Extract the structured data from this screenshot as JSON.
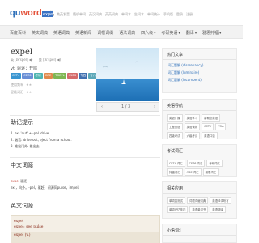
{
  "header": {
    "logo_qu": "qu",
    "logo_word": "word",
    "logo_cd": "词典",
    "search_value": "expel",
    "top_links": [
      "美英发音",
      "随机单词",
      "英汉词典",
      "英英词典",
      "单词本",
      "生词本",
      "单词统计",
      "手机版",
      "登录",
      "注册"
    ]
  },
  "nav": {
    "items": [
      "百度百科",
      "英文词典",
      "英语词典",
      "英语新闻",
      "词根词缀",
      "语法词典",
      "四六级",
      "考研英语",
      "翻译",
      "雅思托福"
    ]
  },
  "word": {
    "headword": "expel",
    "phonetics": [
      "英 [ɪkˈspel] ◀)",
      "美 [ɪkˈspel] ◀)"
    ],
    "definition": "vt. 驱逐；开除",
    "tags": [
      {
        "text": "CET4",
        "color": "#3a96d1"
      },
      {
        "text": "CET6",
        "color": "#6a8fd6"
      },
      {
        "text": "考研",
        "color": "#4fb5b0"
      },
      {
        "text": "GRE",
        "color": "#e0894b"
      },
      {
        "text": "TOEFL",
        "color": "#7fb653"
      },
      {
        "text": "IELTS",
        "color": "#d46a6a"
      },
      {
        "text": "专四",
        "color": "#3f6fb0"
      },
      {
        "text": "专八",
        "color": "#5aa7b8"
      }
    ],
    "rating1_label": "使用频率",
    "rating2_label": "星级词汇",
    "stars": "★★"
  },
  "image": {
    "page": "1 / 3",
    "prev": "‹",
    "next": "›"
  },
  "memory": {
    "title": "助记提示",
    "lines": [
      "1. ex- 'out' + -pel 'drive'.",
      "2. 谐音: drive out, eject from a school.",
      "3. 推出门外, 推出去。"
    ]
  },
  "chinese": {
    "title": "中文词源",
    "word": "expel",
    "word_def": "驱逐",
    "line": "ex-，向外。-pel，驱赶，词源同pulse，impel。"
  },
  "english": {
    "title": "英文词源",
    "lines": [
      "expel",
      "expel: see pulse",
      "expel (v.)"
    ]
  },
  "sidebar": {
    "hot_title": "热门文章",
    "hot_links": [
      "词汇题解 (discrepancy)",
      "词汇题解 (luminaire)",
      "词汇题解 (incumbent)"
    ],
    "nav_title": "英语导航",
    "nav_chips": [
      "英语广播",
      "英语学习",
      "新概念英语",
      "工程日语",
      "英语读物",
      "CCTV",
      "VOA",
      "四级考试",
      "六级考试",
      "英语口语"
    ],
    "exam_title": "考试词汇",
    "exam_chips": [
      "CET4 词汇",
      "CET6 词汇",
      "考研词汇",
      "托福词汇",
      "GRE 词汇",
      "雅思词汇"
    ],
    "rel_title": "相关应用",
    "rel_chips": [
      "单词量测试",
      "词根词缀词典",
      "英语单词听写",
      "单词记忆技巧",
      "英语单词书",
      "英语翻译"
    ],
    "dict_title": "小语词汇"
  }
}
